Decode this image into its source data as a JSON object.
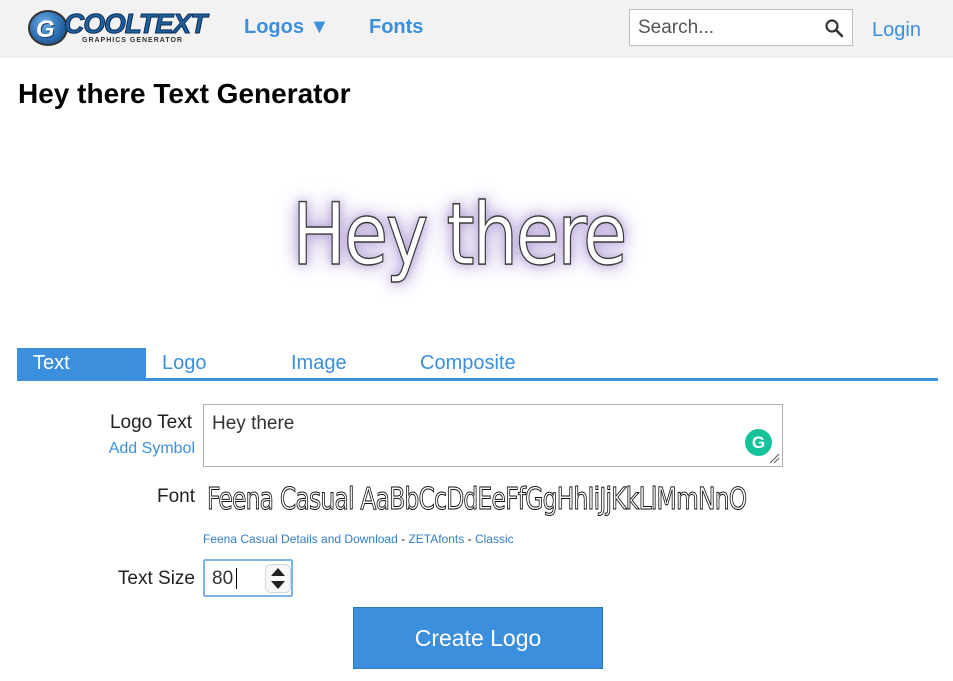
{
  "header": {
    "logo": {
      "word": "COOLTEXT",
      "sub": "GRAPHICS GENERATOR",
      "mark": "G"
    },
    "nav": {
      "logos": "Logos ▼",
      "fonts": "Fonts"
    },
    "search": {
      "placeholder": "Search...",
      "icon": "search-icon"
    },
    "login": "Login"
  },
  "page": {
    "title": "Hey there Text Generator"
  },
  "preview": {
    "text": "Hey there",
    "glow_color": "#b8a5d8"
  },
  "tabs": [
    {
      "label": "Text",
      "active": true
    },
    {
      "label": "Logo",
      "active": false
    },
    {
      "label": "Image",
      "active": false
    },
    {
      "label": "Composite",
      "active": false
    }
  ],
  "form": {
    "logo_text_label": "Logo Text",
    "add_symbol": "Add Symbol",
    "logo_text_value": "Hey there",
    "font_label": "Font",
    "font_sample": "Feena Casual AaBbCcDdEeFfGgHhIiJjKkLlMmNnO",
    "font_links": {
      "details": "Feena Casual Details and Download",
      "sep1": " - ",
      "zeta": "ZETAfonts",
      "sep2": " - ",
      "classic": "Classic"
    },
    "text_size_label": "Text Size",
    "text_size_value": "80",
    "create_button": "Create Logo"
  },
  "colors": {
    "accent": "#3b8fdc",
    "grammarly": "#15c39a"
  }
}
